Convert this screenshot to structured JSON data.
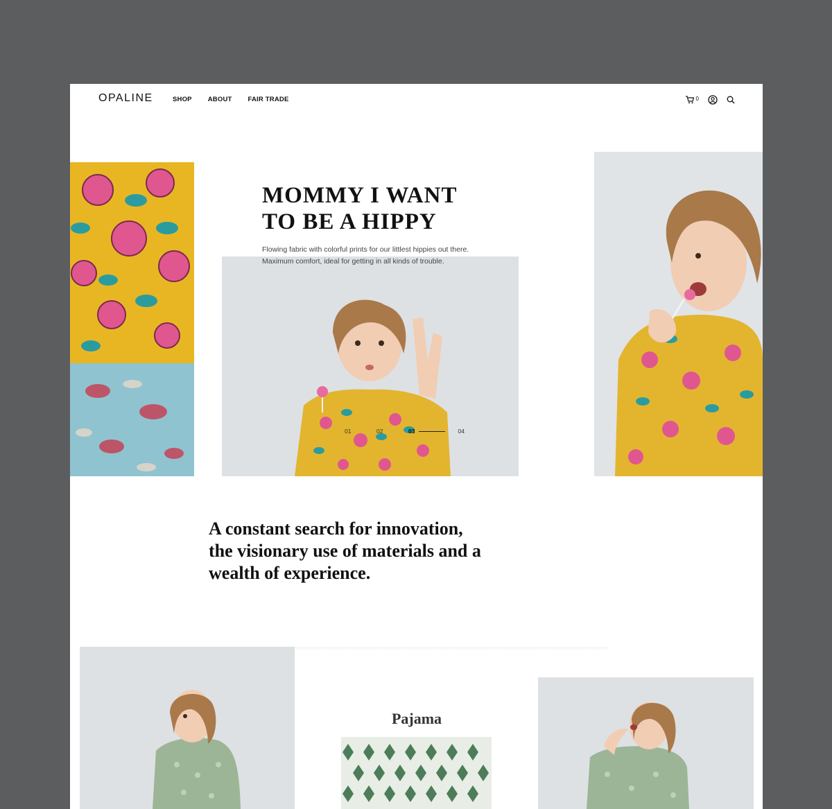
{
  "header": {
    "logo": "OPALINE",
    "nav": [
      "SHOP",
      "ABOUT",
      "FAIR TRADE"
    ],
    "cart_count": "0"
  },
  "icons": {
    "cart": "cart-icon",
    "account": "user-icon",
    "search": "search-icon"
  },
  "hero": {
    "title": "MOMMY I WANT TO BE A HIPPY",
    "description_line1": "Flowing fabric with colorful prints for our littlest hippies out there.",
    "description_line2": "Maximum comfort, ideal for getting in all kinds of trouble.",
    "slides": [
      "01",
      "02",
      "03",
      "04"
    ],
    "active_slide": "03"
  },
  "statement": "A constant search for innovation, the visionary use of materials and a wealth of experience.",
  "products": {
    "pajama_title": "Pajama"
  },
  "colors": {
    "background": "#5c5d5f",
    "page": "#ffffff",
    "mustard": "#e9b623",
    "pink": "#e0578f",
    "teal": "#2a9ca0",
    "sage": "#8fa98a"
  }
}
